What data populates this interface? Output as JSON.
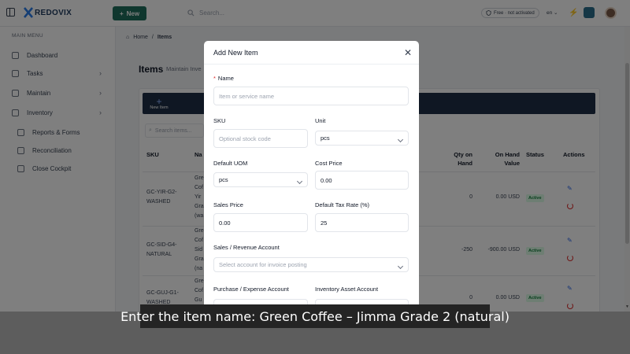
{
  "topbar": {
    "app_name": "REDOVIX",
    "new_label": "New",
    "search_placeholder": "Search...",
    "plan_badge": "Free · not activated",
    "language": "en"
  },
  "sidebar": {
    "heading": "MAIN MENU",
    "items": [
      {
        "label": "Dashboard"
      },
      {
        "label": "Tasks"
      },
      {
        "label": "Maintain"
      },
      {
        "label": "Inventory"
      }
    ],
    "sub_items": [
      {
        "label": "Reports & Forms"
      },
      {
        "label": "Reconciliation"
      },
      {
        "label": "Close Cockpit"
      }
    ]
  },
  "breadcrumb": {
    "home": "Home",
    "separator": "/",
    "current": "Items"
  },
  "page": {
    "title": "Items",
    "subtitle": "Maintain Inve"
  },
  "toolbar": {
    "new_item": "New Item"
  },
  "table": {
    "search_placeholder": "Search items...",
    "headers": {
      "sku": "SKU",
      "name": "Na",
      "qty_l1": "Qty on",
      "qty_l2": "Hand",
      "val_l1": "On Hand",
      "val_l2": "Value",
      "status": "Status",
      "actions": "Actions"
    },
    "rows": [
      {
        "sku_l1": "GC-YIR-G2-",
        "sku_l2": "WASHED",
        "name_l1": "Gre",
        "name_l2": "Cof",
        "name_l3": "Yir",
        "name_l4": "Gra",
        "name_l5": "(wa",
        "qty": "0",
        "value": "0.00 USD",
        "status": "Active"
      },
      {
        "sku_l1": "GC-SID-G4-",
        "sku_l2": "NATURAL",
        "name_l1": "Gre",
        "name_l2": "Cof",
        "name_l3": "Sid",
        "name_l4": "Gra",
        "name_l5": "(na",
        "qty": "-250",
        "value": "-900.00 USD",
        "status": "Active"
      },
      {
        "sku_l1": "GC-GUJ-G1-",
        "sku_l2": "WASHED",
        "name_l1": "Gre",
        "name_l2": "Cof",
        "name_l3": "Gu",
        "qty": "0",
        "value": "0.00 USD",
        "status": "Active"
      }
    ]
  },
  "modal": {
    "title": "Add New Item",
    "name_label": "Name",
    "name_required": "*",
    "name_placeholder": "Item or service name",
    "sku_label": "SKU",
    "sku_placeholder": "Optional stock code",
    "unit_label": "Unit",
    "unit_value": "pcs",
    "default_uom_label": "Default UOM",
    "default_uom_value": "pcs",
    "cost_price_label": "Cost Price",
    "cost_price_value": "0.00",
    "sales_price_label": "Sales Price",
    "sales_price_value": "0.00",
    "tax_rate_label": "Default Tax Rate (%)",
    "tax_rate_value": "25",
    "sales_account_label": "Sales / Revenue Account",
    "sales_account_placeholder": "Select account for invoice posting",
    "purchase_account_label": "Purchase / Expense Account",
    "inventory_account_label": "Inventory Asset Account"
  },
  "caption": {
    "text": "Enter the item name: Green Coffee – Jimma Grade 2 (natural)"
  },
  "colors": {
    "accent_green": "#1f6f5c",
    "toolbar_navy": "#1f2f46",
    "required_red": "#dc2626",
    "active_green": "#15803d"
  }
}
